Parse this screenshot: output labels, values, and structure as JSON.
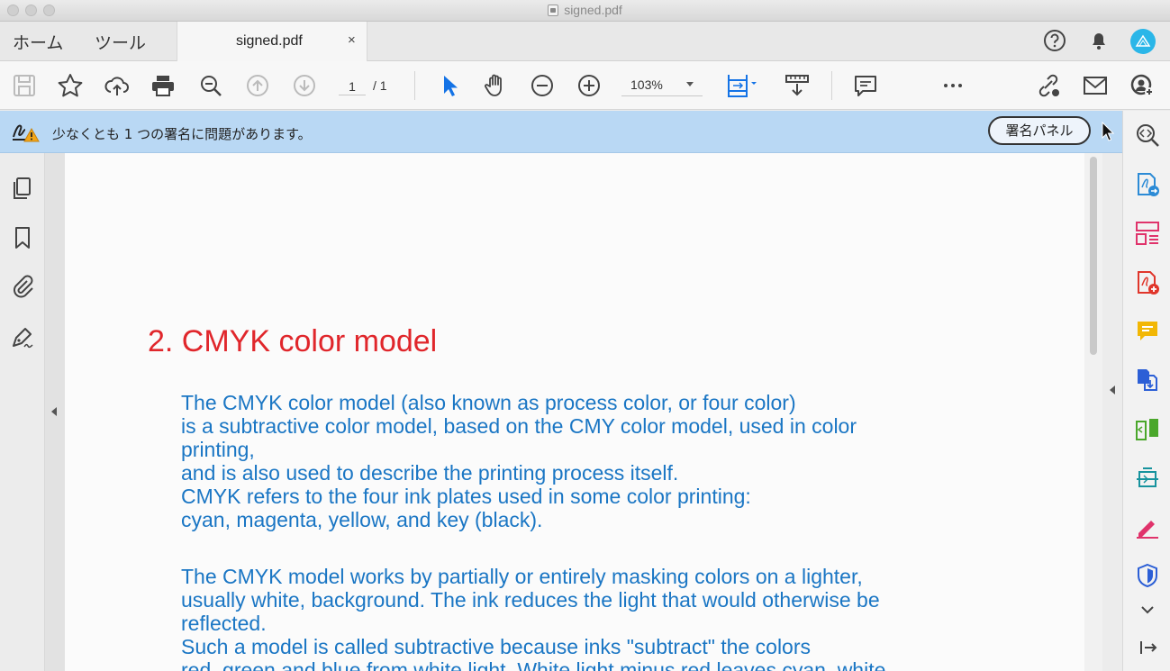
{
  "window": {
    "title": "signed.pdf"
  },
  "tabs": {
    "home": "ホーム",
    "tools": "ツール",
    "document": "signed.pdf",
    "close": "×"
  },
  "toolbar": {
    "page_current": "1",
    "page_total": "/ 1",
    "zoom": "103%"
  },
  "banner": {
    "message": "少なくとも 1 つの署名に問題があります。",
    "button": "署名パネル"
  },
  "document": {
    "heading": "2. CMYK color model",
    "paragraph1": [
      "The CMYK color model (also known as process color, or four color)",
      "is a subtractive color model, based on the CMY color model, used in color",
      "printing,",
      "and is also used to describe the printing process itself.",
      "CMYK refers to the four ink plates used in some color printing:",
      "cyan, magenta, yellow, and key (black)."
    ],
    "paragraph2": [
      "The CMYK model works by partially or entirely masking colors on a lighter,",
      "usually white, background. The ink reduces the light that would otherwise be",
      "reflected.",
      "Such a model is called subtractive because inks \"subtract\" the colors",
      "red, green and blue from white light. White light minus red leaves cyan, white"
    ]
  },
  "colors": {
    "heading": "#e0262b",
    "body_text": "#1a76c4",
    "banner": "#b9d8f4",
    "accent": "#1473e6"
  }
}
